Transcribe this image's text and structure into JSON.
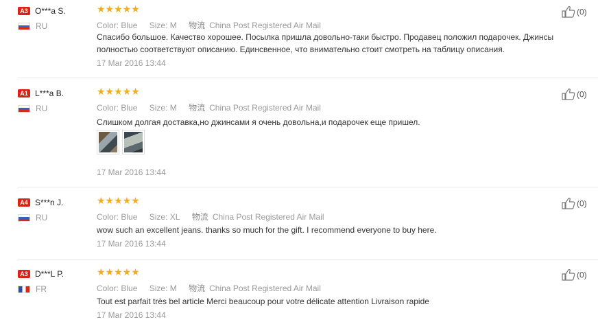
{
  "helpful_count_label": "(0)",
  "reviews": [
    {
      "badge": "A3",
      "name": "O***a S.",
      "country": "RU",
      "stars": "★★★★★",
      "color_label": "Color:",
      "color": "Blue",
      "size_label": "Size:",
      "size": "M",
      "shipping_icon": "物流",
      "shipping": "China Post Registered Air Mail",
      "text": "Спасибо большое. Качество хорошее. Посылка пришла довольно-таки быстро. Продавец положил подарочек. Джинсы полностью соответствуют описанию. Единсвенное, что внимательно стоит смотреть на таблицу описания.",
      "date": "17 Mar 2016 13:44",
      "helpful": "(0)"
    },
    {
      "badge": "A1",
      "name": "L***a B.",
      "country": "RU",
      "stars": "★★★★★",
      "color_label": "Color:",
      "color": "Blue",
      "size_label": "Size:",
      "size": "M",
      "shipping_icon": "物流",
      "shipping": "China Post Registered Air Mail",
      "text": "Слишком долгая доставка,но джинсами я очень довольна,и подарочек еще пришел.",
      "date": "17 Mar 2016 13:44",
      "helpful": "(0)"
    },
    {
      "badge": "A4",
      "name": "S***n J.",
      "country": "RU",
      "stars": "★★★★★",
      "color_label": "Color:",
      "color": "Blue",
      "size_label": "Size:",
      "size": "XL",
      "shipping_icon": "物流",
      "shipping": "China Post Registered Air Mail",
      "text": "wow such an excellent jeans. thanks so much for the gift. I recommend everyone to buy here.",
      "date": "17 Mar 2016 13:44",
      "helpful": "(0)"
    },
    {
      "badge": "A3",
      "name": "D***L P.",
      "country": "FR",
      "stars": "★★★★★",
      "color_label": "Color:",
      "color": "Blue",
      "size_label": "Size:",
      "size": "M",
      "shipping_icon": "物流",
      "shipping": "China Post Registered Air Mail",
      "text": "Tout est parfait très bel article Merci beaucoup pour votre délicate attention Livraison rapide",
      "date": "17 Mar 2016 13:44",
      "helpful": "(0)"
    }
  ],
  "colors": {
    "badge": "#d6241b",
    "star": "#f0ad22",
    "muted": "#999999"
  }
}
